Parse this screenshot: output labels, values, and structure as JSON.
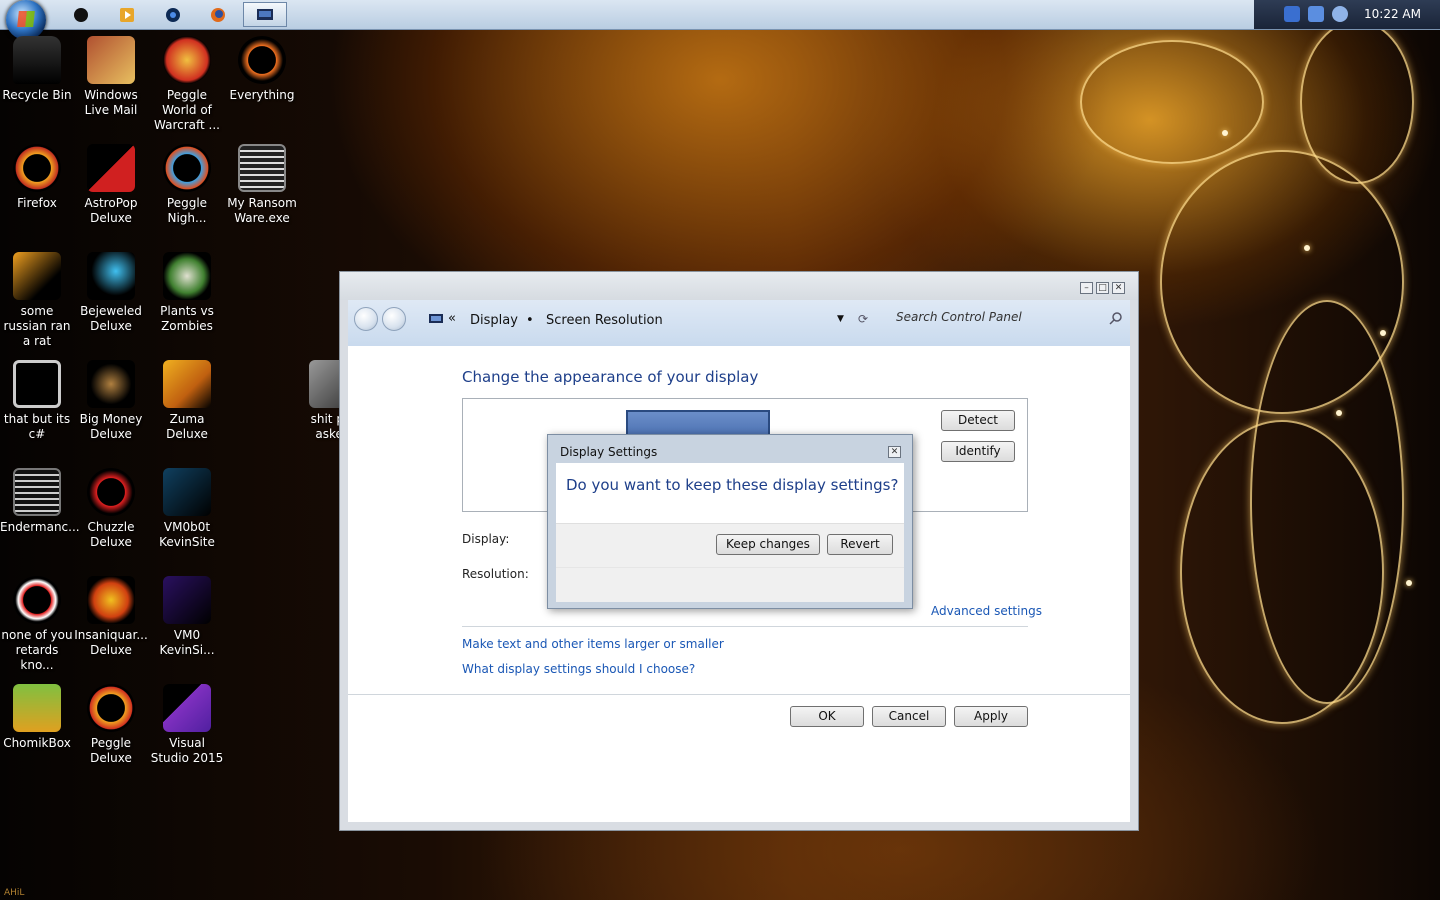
{
  "taskbar": {
    "clock": "10:22 AM",
    "pinned": [
      "media-player-icon",
      "firefox-icon",
      "chrome-icon",
      "folder-icon",
      "control-panel-icon"
    ]
  },
  "desktop": {
    "icons": [
      {
        "label": "Recycle Bin"
      },
      {
        "label": "Windows Live Mail"
      },
      {
        "label": "Peggle World of Warcraft ..."
      },
      {
        "label": "Everything"
      },
      {
        "label": "Firefox"
      },
      {
        "label": "AstroPop Deluxe"
      },
      {
        "label": "Peggle Nigh..."
      },
      {
        "label": "My Ransom Ware.exe"
      },
      {
        "label": "some russian ran a rat"
      },
      {
        "label": "Bejeweled Deluxe"
      },
      {
        "label": "Plants vs Zombies"
      },
      {
        "label": "that but its c#"
      },
      {
        "label": "Big Money Deluxe"
      },
      {
        "label": "Zuma Deluxe"
      },
      {
        "label": "shit p... asked"
      },
      {
        "label": "Endermanc..."
      },
      {
        "label": "Chuzzle Deluxe"
      },
      {
        "label": "VM0b0t KevinSite"
      },
      {
        "label": "none of you retards kno..."
      },
      {
        "label": "Insaniquar... Deluxe"
      },
      {
        "label": "VM0 KevinSi..."
      },
      {
        "label": "ChomikBox"
      },
      {
        "label": "Peggle Deluxe"
      },
      {
        "label": "Visual Studio 2015"
      }
    ],
    "credit": "AHiL"
  },
  "window": {
    "breadcrumb": {
      "sep": "«",
      "display": "Display",
      "bullet": "•",
      "current": "Screen Resolution"
    },
    "search_placeholder": "Search Control Panel",
    "heading": "Change the appearance of your display",
    "detect": "Detect",
    "identify": "Identify",
    "display_label": "Display:",
    "resolution_label": "Resolution:",
    "advanced": "Advanced settings",
    "link1": "Make text and other items larger or smaller",
    "link2": "What display settings should I choose?",
    "ok": "OK",
    "cancel": "Cancel",
    "apply": "Apply"
  },
  "dialog": {
    "title": "Display Settings",
    "question": "Do you want to keep these display settings?",
    "keep": "Keep changes",
    "revert": "Revert"
  }
}
